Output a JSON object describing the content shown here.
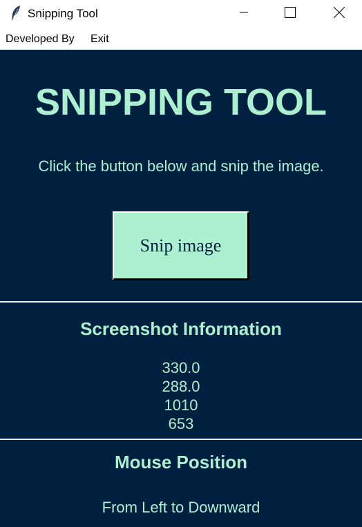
{
  "window": {
    "title": "Snipping Tool",
    "icon": "feather-icon",
    "controls": [
      "minimize-icon",
      "maximize-icon",
      "close-icon"
    ]
  },
  "menu": {
    "items": [
      {
        "label": "Developed By"
      },
      {
        "label": "Exit"
      }
    ]
  },
  "main": {
    "heading": "SNIPPING TOOL",
    "instruction": "Click the button below and snip the image.",
    "snip_button_label": "Snip image",
    "info_section": {
      "title": "Screenshot Information",
      "values": [
        "330.0",
        "288.0",
        "1010",
        "653"
      ]
    },
    "mouse_section": {
      "title": "Mouse Position",
      "text": "From Left to Downward"
    }
  },
  "colors": {
    "background": "#00203f",
    "accent": "#adefd1",
    "titlebar": "#ffffff"
  }
}
